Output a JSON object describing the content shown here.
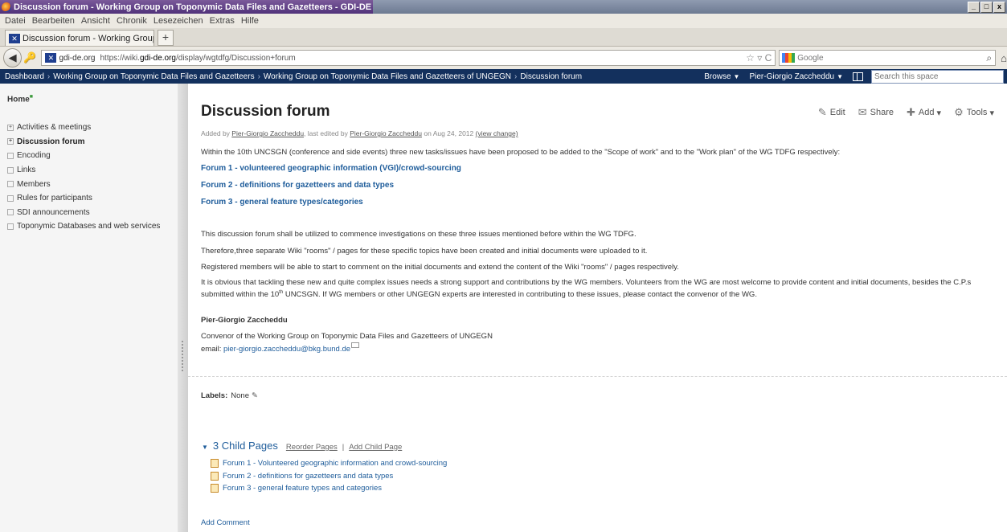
{
  "browser": {
    "window_title": "Discussion forum - Working Group on Toponymic Data Files and Gazetteers - GDI-DE Wiki - Mozilla Firefox",
    "menu": [
      "Datei",
      "Bearbeiten",
      "Ansicht",
      "Chronik",
      "Lesezeichen",
      "Extras",
      "Hilfe"
    ],
    "tab_title": "Discussion forum - Working Group on Topon...",
    "new_tab": "+",
    "domain": "gdi-de.org",
    "url_prefix": "https://wiki.",
    "url_host": "gdi-de.org",
    "url_path": "/display/wgtdfg/Discussion+forum",
    "search_engine": "Google",
    "win_controls": [
      "_",
      "□",
      "x"
    ]
  },
  "header": {
    "breadcrumbs": [
      "Dashboard",
      "Working Group on Toponymic Data Files and Gazetteers",
      "Working Group on Toponymic Data Files and Gazetteers of UNGEGN",
      "Discussion forum"
    ],
    "browse_label": "Browse",
    "user_name": "Pier-Giorgio Zaccheddu",
    "search_placeholder": "Search this space"
  },
  "sidebar": {
    "home_label": "Home",
    "items": [
      {
        "label": "Activities & meetings",
        "marker": "+"
      },
      {
        "label": "Discussion forum",
        "marker": "+"
      },
      {
        "label": "Encoding",
        "marker": ""
      },
      {
        "label": "Links",
        "marker": ""
      },
      {
        "label": "Members",
        "marker": ""
      },
      {
        "label": "Rules for participants",
        "marker": ""
      },
      {
        "label": "SDI announcements",
        "marker": ""
      },
      {
        "label": "Toponymic Databases and web services",
        "marker": ""
      }
    ]
  },
  "page": {
    "title": "Discussion forum",
    "actions": {
      "edit": "Edit",
      "share": "Share",
      "add": "Add",
      "tools": "Tools"
    },
    "byline": {
      "added_by": "Added by ",
      "creator": "Pier-Giorgio Zaccheddu",
      "last_edited": ", last edited by ",
      "editor": "Pier-Giorgio Zaccheddu",
      "date": " on Aug 24, 2012 ",
      "view_change": "(view change)"
    },
    "intro": "Within the 10th UNCSGN (conference and side events) three new tasks/issues have been proposed to be added to the \"Scope of work\" and to the \"Work plan\" of the WG TDFG respectively:",
    "forums": [
      "Forum 1 - volunteered geographic information (VGI)/crowd-sourcing",
      "Forum 2 - definitions for gazetteers and data types",
      "Forum 3 - general feature types/categories"
    ],
    "para1": "This discussion forum shall be utilized to commence investigations on these three issues mentioned before within the WG TDFG.",
    "para2": "Therefore,three separate Wiki \"rooms\" / pages for these specific topics have been created and initial documents were uploaded to it.",
    "para3": "Registered members will be able to start to comment on the initial documents and extend the content of the Wiki \"rooms\" / pages respectively.",
    "para4_a": "It is obvious that tackling these new and quite complex issues needs a strong support and contributions by the WG members. Volunteers from the WG are most welcome to provide content and initial documents, besides the C.P.s submitted within the 10",
    "para4_sup": "th",
    "para4_b": " UNCSGN. If WG members or other UNGEGN experts are interested in contributing to these issues, please contact the convenor of the WG.",
    "signature": {
      "name": "Pier-Giorgio Zaccheddu",
      "role": "Convenor of the Working Group on Toponymic Data Files and Gazetteers of UNGEGN",
      "email_label": "email:  ",
      "email": "pier-giorgio.zaccheddu@bkg.bund.de"
    },
    "labels": {
      "label": "Labels:",
      "value": "None"
    },
    "child_pages": {
      "count_label": "3 Child Pages",
      "reorder": "Reorder Pages",
      "separator": "|",
      "add_child": "Add Child Page",
      "items": [
        "Forum 1 - Volunteered geographic information and crowd-sourcing",
        "Forum 2 - definitions for gazetteers and data types",
        "Forum 3 - general feature types and categories"
      ]
    },
    "add_comment": "Add Comment"
  },
  "colors": {
    "header_bg": "#13305d",
    "link": "#1f5d9b",
    "sidebar_bg": "#f5f5f5"
  },
  "icons": {
    "edit": "pencil-icon",
    "share": "envelope-icon",
    "add": "plus-icon",
    "tools": "gear-icon"
  }
}
